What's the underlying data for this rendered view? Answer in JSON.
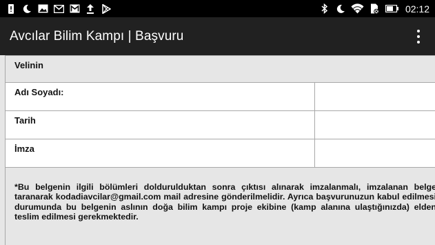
{
  "status_bar": {
    "left_icons": [
      "alert-icon",
      "do-not-disturb-moon-icon",
      "image-icon",
      "mail-icon",
      "gmail-icon",
      "upload-icon",
      "play-store-icon"
    ],
    "right_icons": [
      "bluetooth-icon",
      "do-not-disturb-moon-icon",
      "wifi-icon",
      "no-sim-icon",
      "battery-icon"
    ],
    "time": "02:12"
  },
  "app_bar": {
    "title": "Avcılar Bilim Kampı | Başvuru",
    "menu_icon": "overflow-menu-icon"
  },
  "form": {
    "section_title": "Velinin",
    "fields": [
      {
        "label": "Adı Soyadı:",
        "value": ""
      },
      {
        "label": "Tarih",
        "value": ""
      },
      {
        "label": "İmza",
        "value": ""
      }
    ],
    "note": "*Bu belgenin ilgili bölümleri doldurulduktan sonra çıktısı alınarak imzalanmalı, imzalanan belge taranarak kodadiavcilar@gmail.com mail adresine gönderilmelidir. Ayrıca başvurunuzun kabul edilmesi durumunda bu belgenin aslının doğa bilim kampı proje ekibine (kamp alanına ulaştığınızda) elden teslim edilmesi gerekmektedir."
  }
}
